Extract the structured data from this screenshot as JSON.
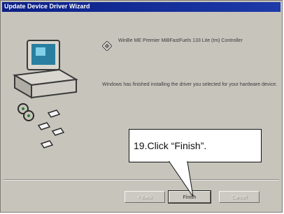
{
  "window": {
    "title": "Update Device Driver Wizard"
  },
  "wizard": {
    "device_name": "WinBe ME Premier MiBFastFuels 133 Lite (tm) Controller",
    "message": "Windows has finished installing the driver you selected for your hardware device."
  },
  "buttons": {
    "back": "< Back",
    "finish": "Finish",
    "cancel": "Cancel"
  },
  "callout": {
    "text": "19.Click “Finish”."
  },
  "colors": {
    "titlebar": "#0b1f85",
    "dialog_face": "#c7c4bc",
    "monitor_screen": "#2a7fa0"
  }
}
